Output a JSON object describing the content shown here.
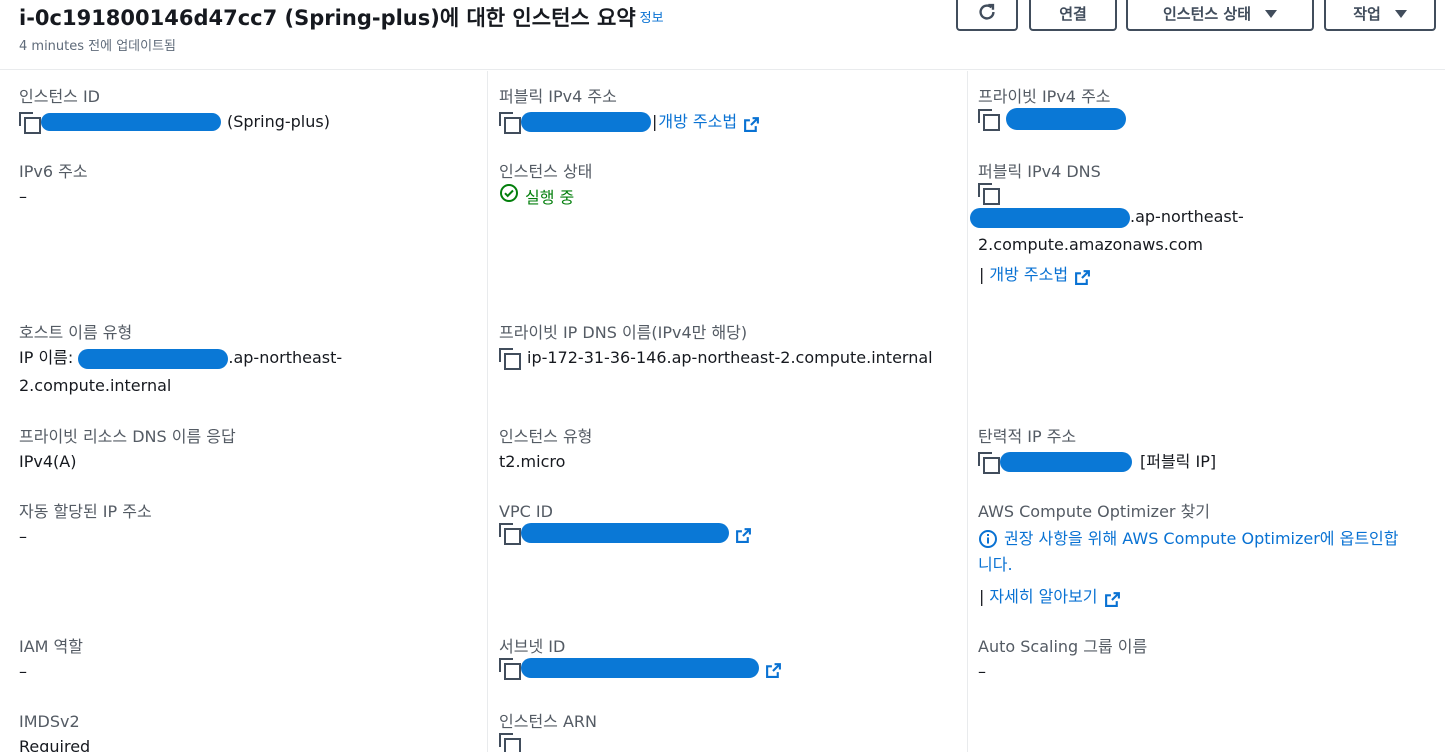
{
  "header": {
    "title": "i-0c191800146d47cc7 (Spring-plus)에 대한 인스턴스 요약",
    "info_link": "정보",
    "subtitle": "4 minutes 전에 업데이트됨",
    "buttons": {
      "refresh_icon": "refresh-icon",
      "connect": "연결",
      "instance_state": "인스턴스 상태",
      "actions": "작업"
    }
  },
  "fields": {
    "instance_id": {
      "label": "인스턴스 ID",
      "value": "(Spring-plus)"
    },
    "public_ipv4": {
      "label": "퍼블릭 IPv4 주소",
      "link": "개방 주소법"
    },
    "private_ipv4": {
      "label": "프라이빗 IPv4 주소"
    },
    "ipv6": {
      "label": "IPv6 주소",
      "value": "–"
    },
    "instance_state": {
      "label": "인스턴스 상태",
      "value": "실행 중"
    },
    "public_dns": {
      "label": "퍼블릭 IPv4 DNS",
      "value_suffix": ".ap-northeast-",
      "value_line2": "2.compute.amazonaws.com",
      "link": "개방 주소법"
    },
    "hostname_type": {
      "label": "호스트 이름 유형",
      "value_prefix": "IP 이름: ",
      "value_suffix": ".ap-northeast-",
      "value_line2": "2.compute.internal"
    },
    "private_dns": {
      "label": "프라이빗 IP DNS 이름(IPv4만 해당)",
      "value": "ip-172-31-36-146.ap-northeast-2.compute.internal"
    },
    "resource_dns": {
      "label": "프라이빗 리소스 DNS 이름 응답",
      "value": "IPv4(A)"
    },
    "instance_type": {
      "label": "인스턴스 유형",
      "value": "t2.micro"
    },
    "elastic_ip": {
      "label": "탄력적 IP 주소",
      "value_suffix": "[퍼블릭 IP]"
    },
    "auto_ip": {
      "label": "자동 할당된 IP 주소",
      "value": "–"
    },
    "vpc_id": {
      "label": "VPC ID"
    },
    "optimizer": {
      "label": "AWS Compute Optimizer 찾기",
      "text_line1": "권장 사항을 위해 AWS Compute Optimizer에 옵트인합",
      "text_line2": "니다.",
      "link": "자세히 알아보기"
    },
    "iam_role": {
      "label": "IAM 역할",
      "value": "–"
    },
    "subnet_id": {
      "label": "서브넷 ID"
    },
    "asg_name": {
      "label": "Auto Scaling 그룹 이름",
      "value": "–"
    },
    "imdsv2": {
      "label": "IMDSv2",
      "value": "Required"
    },
    "instance_arn": {
      "label": "인스턴스 ARN"
    }
  },
  "colors": {
    "link": "#0972d3",
    "success": "#037f0c",
    "redaction": "#0a78d6"
  }
}
